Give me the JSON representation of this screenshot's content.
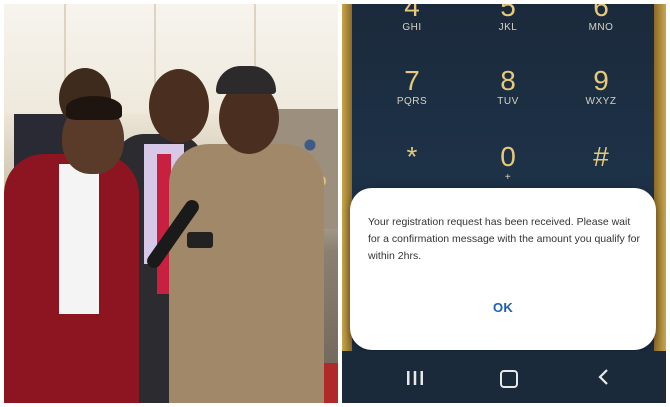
{
  "keypad": {
    "row0": [
      {
        "digit": "4",
        "letters": "GHI"
      },
      {
        "digit": "5",
        "letters": "JKL"
      },
      {
        "digit": "6",
        "letters": "MNO"
      }
    ],
    "row1": [
      {
        "digit": "7",
        "letters": "PQRS"
      },
      {
        "digit": "8",
        "letters": "TUV"
      },
      {
        "digit": "9",
        "letters": "WXYZ"
      }
    ],
    "row2": [
      {
        "digit": "*",
        "letters": ""
      },
      {
        "digit": "0",
        "letters": "+"
      },
      {
        "digit": "#",
        "letters": ""
      }
    ]
  },
  "dialog": {
    "message": "Your registration request has been received. Please wait for a confirmation message with the amount you qualify for within 2hrs.",
    "ok_label": "OK"
  },
  "navbar": {
    "recents_icon": "recent-apps-icon",
    "home_icon": "home-icon",
    "back_icon": "back-icon"
  },
  "colors": {
    "accent_gold": "#e6c97a",
    "ok_blue": "#1f5db3",
    "screen_bg": "#1d3147"
  }
}
